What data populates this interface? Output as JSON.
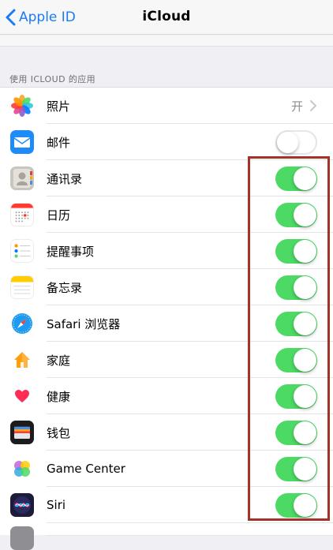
{
  "navbar": {
    "back_label": "Apple ID",
    "title": "iCloud"
  },
  "section": {
    "header": "使用 ICLOUD 的应用"
  },
  "rows": [
    {
      "label": "照片",
      "icon": "photos-icon",
      "control": "detail",
      "detail": "开"
    },
    {
      "label": "邮件",
      "icon": "mail-icon",
      "control": "toggle",
      "on": false
    },
    {
      "label": "通讯录",
      "icon": "contacts-icon",
      "control": "toggle",
      "on": true
    },
    {
      "label": "日历",
      "icon": "calendar-icon",
      "control": "toggle",
      "on": true
    },
    {
      "label": "提醒事项",
      "icon": "reminders-icon",
      "control": "toggle",
      "on": true
    },
    {
      "label": "备忘录",
      "icon": "notes-icon",
      "control": "toggle",
      "on": true
    },
    {
      "label": "Safari 浏览器",
      "icon": "safari-icon",
      "control": "toggle",
      "on": true
    },
    {
      "label": "家庭",
      "icon": "home-icon",
      "control": "toggle",
      "on": true
    },
    {
      "label": "健康",
      "icon": "health-icon",
      "control": "toggle",
      "on": true
    },
    {
      "label": "钱包",
      "icon": "wallet-icon",
      "control": "toggle",
      "on": true
    },
    {
      "label": "Game Center",
      "icon": "game-center-icon",
      "control": "toggle",
      "on": true
    },
    {
      "label": "Siri",
      "icon": "siri-icon",
      "control": "toggle",
      "on": true
    }
  ],
  "colors": {
    "accent": "#1a7cf5",
    "toggle_on": "#4cd964",
    "highlight_box": "#a23328"
  }
}
